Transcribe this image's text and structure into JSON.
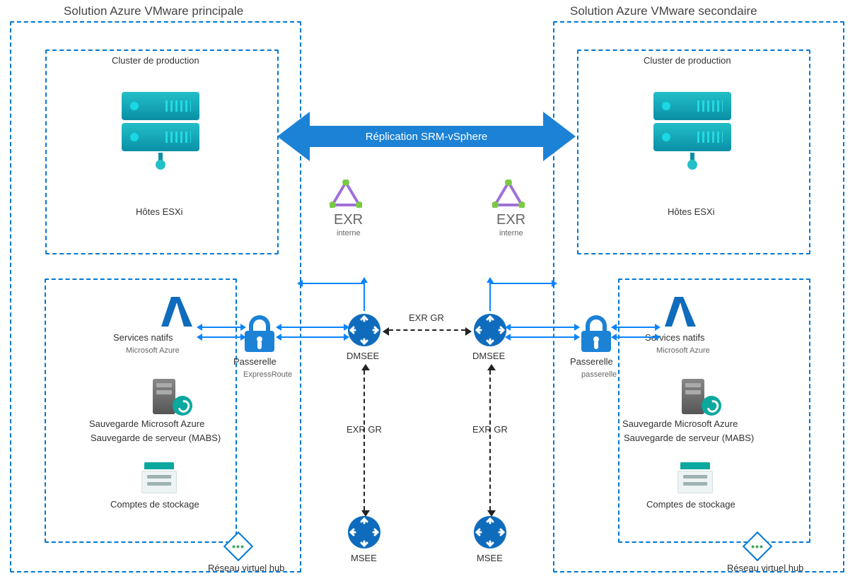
{
  "titles": {
    "primary": "Solution Azure VMware principale",
    "secondary": "Solution Azure VMware secondaire"
  },
  "clusters": {
    "primary_header": "Cluster de production",
    "secondary_header": "Cluster de production",
    "esxi": "Hôtes ESXi"
  },
  "srm": {
    "label": "Réplication SRM-vSphere"
  },
  "exr": {
    "name": "EXR",
    "sub": "interne"
  },
  "gateway": {
    "primary_label": "Passerelle",
    "primary_sub": "ExpressRoute",
    "secondary_label": "Passerelle",
    "secondary_sub": "passerelle"
  },
  "routers": {
    "dmsee": "DMSEE",
    "msee": "MSEE",
    "exr_gr": "EXR GR"
  },
  "hub_services": {
    "native": "Services natifs",
    "native_sub": "Microsoft Azure",
    "backup": "Sauvegarde Microsoft Azure",
    "backup_sub": "Sauvegarde de serveur (MABS)",
    "storage": "Comptes de stockage",
    "vnet": "Réseau virtuel hub"
  }
}
